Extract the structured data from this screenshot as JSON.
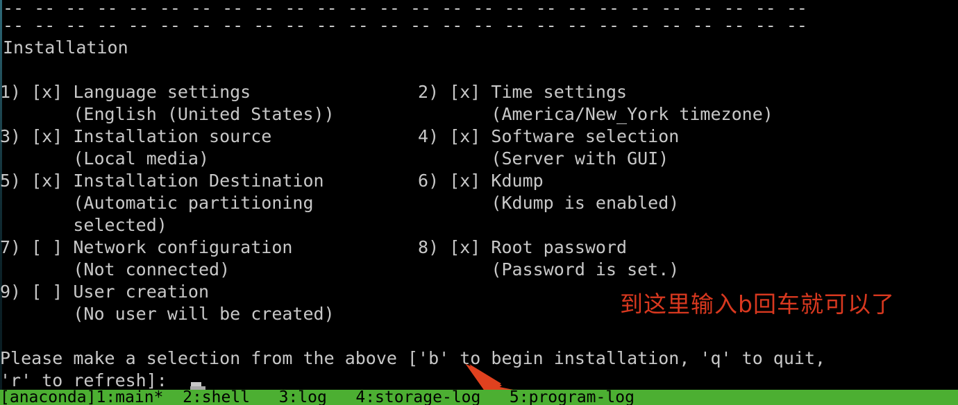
{
  "terminal": {
    "separator_top": "-- -- -- -- -- -- -- -- -- -- -- -- -- -- -- -- -- -- -- -- -- -- -- -- -- --",
    "separator_bottom": "-- -- -- -- -- -- -- -- -- -- -- -- -- -- -- -- -- -- -- -- -- -- -- -- -- --",
    "title": "Installation",
    "menu_lines": [
      "1) [x] Language settings                2) [x] Time settings",
      "       (English (United States))               (America/New_York timezone)",
      "3) [x] Installation source              4) [x] Software selection",
      "       (Local media)                           (Server with GUI)",
      "5) [x] Installation Destination         6) [x] Kdump",
      "       (Automatic partitioning                 (Kdump is enabled)",
      "       selected)",
      "7) [ ] Network configuration            8) [x] Root password",
      "       (Not connected)                         (Password is set.)",
      "9) [ ] User creation",
      "       (No user will be created)"
    ],
    "menu_items": [
      {
        "number": "1)",
        "checkbox": "[x]",
        "label": "Language settings",
        "detail": "(English (United States))",
        "column": "left"
      },
      {
        "number": "2)",
        "checkbox": "[x]",
        "label": "Time settings",
        "detail": "(America/New_York timezone)",
        "column": "right"
      },
      {
        "number": "3)",
        "checkbox": "[x]",
        "label": "Installation source",
        "detail": "(Local media)",
        "column": "left"
      },
      {
        "number": "4)",
        "checkbox": "[x]",
        "label": "Software selection",
        "detail": "(Server with GUI)",
        "column": "right"
      },
      {
        "number": "5)",
        "checkbox": "[x]",
        "label": "Installation Destination",
        "detail": "(Automatic partitioning selected)",
        "column": "left"
      },
      {
        "number": "6)",
        "checkbox": "[x]",
        "label": "Kdump",
        "detail": "(Kdump is enabled)",
        "column": "right"
      },
      {
        "number": "7)",
        "checkbox": "[ ]",
        "label": "Network configuration",
        "detail": "(Not connected)",
        "column": "left"
      },
      {
        "number": "8)",
        "checkbox": "[x]",
        "label": "Root password",
        "detail": "(Password is set.)",
        "column": "right"
      },
      {
        "number": "9)",
        "checkbox": "[ ]",
        "label": "User creation",
        "detail": "(No user will be created)",
        "column": "left"
      }
    ],
    "prompt_line_1": "Please make a selection from the above ['b' to begin installation, 'q' to quit,",
    "prompt_line_2": "'r' to refresh]: ",
    "input_value": ""
  },
  "statusbar": {
    "text": "[anaconda]1:main*  2:shell   3:log   4:storage-log   5:program-log"
  },
  "annotation": {
    "text": "到这里输入b回车就可以了",
    "color": "#d8381f",
    "arrow_color": "#e0411f"
  },
  "colors": {
    "background": "#000000",
    "foreground": "#c8c8c8",
    "statusbar_bg": "#4caf32",
    "statusbar_fg": "#000000",
    "edge": "#2e6b7a"
  }
}
